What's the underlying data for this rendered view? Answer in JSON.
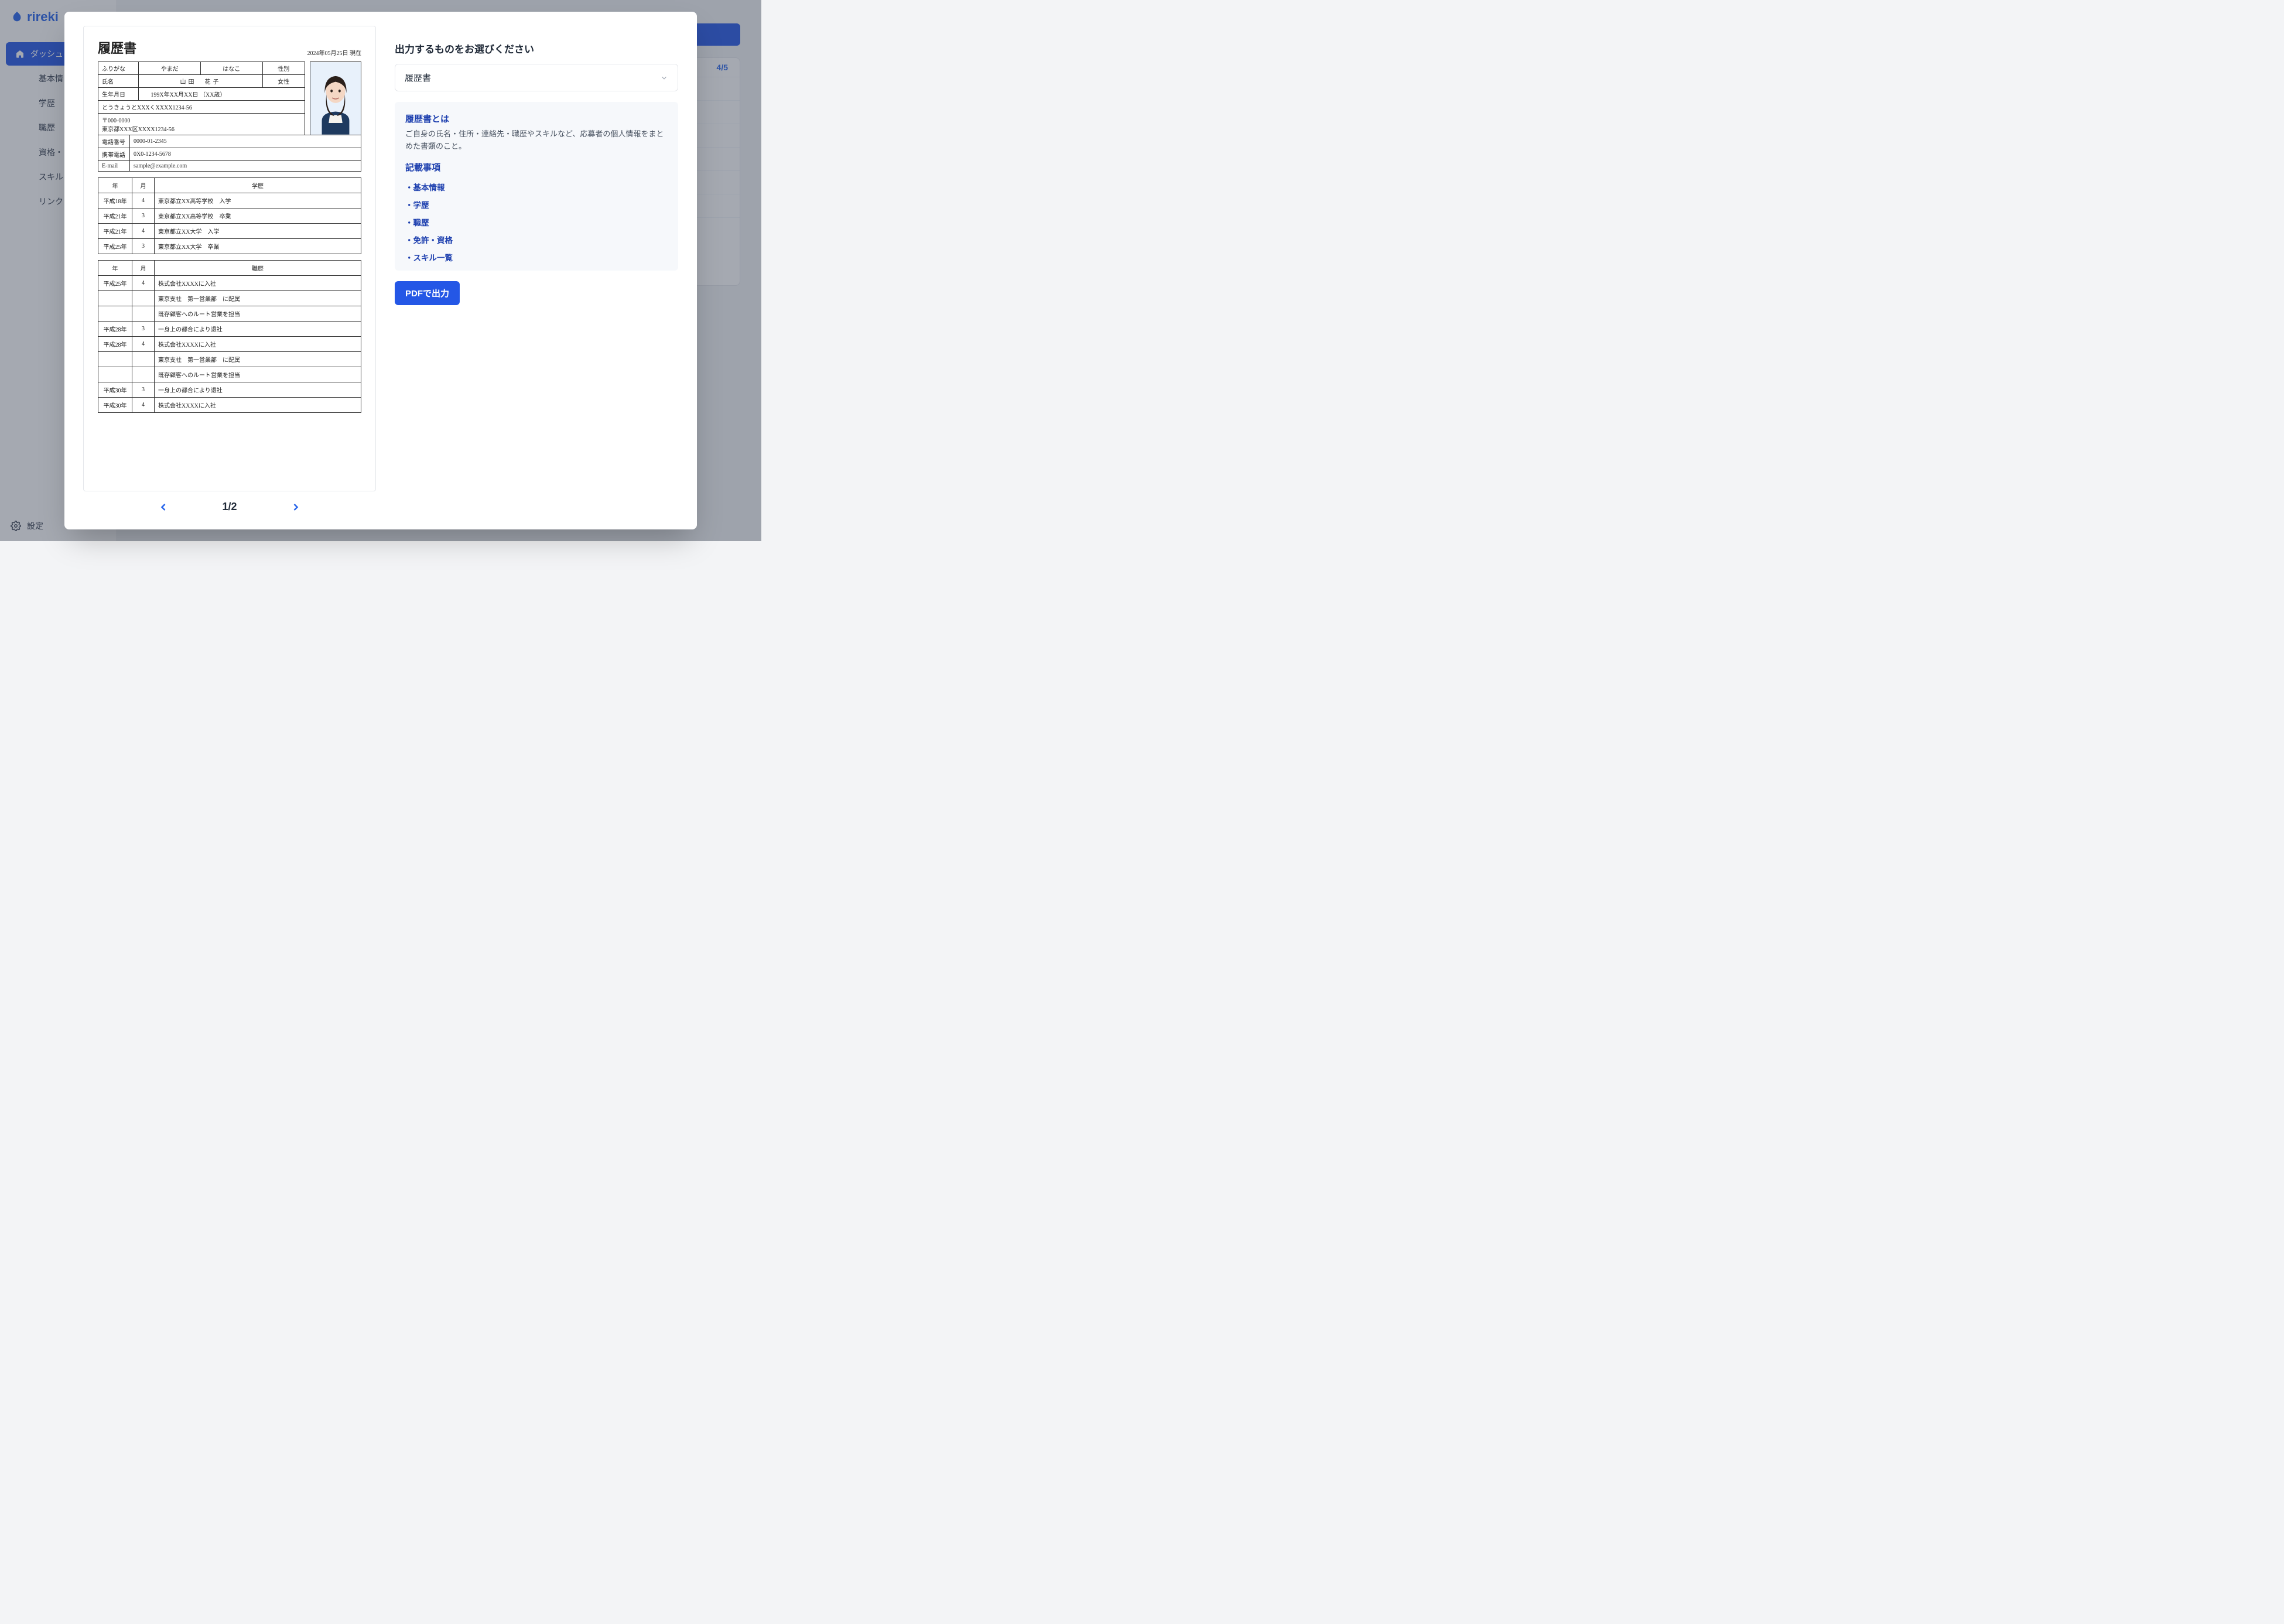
{
  "brand": "rireki",
  "sidebar": {
    "active": "ダッシュ",
    "items": [
      "基本情",
      "学歴",
      "職歴",
      "資格・",
      "スキル",
      "リンク"
    ],
    "settings": "設定"
  },
  "background": {
    "counter": "4/5"
  },
  "modal": {
    "preview": {
      "title": "履歴書",
      "date_label": "2024年05月25日 現在",
      "labels": {
        "furigana": "ふりがな",
        "name": "氏名",
        "gender_label": "性別",
        "dob_label": "生年月日",
        "phone_label": "電話番号",
        "mobile_label": "携帯電話",
        "email_label": "E-mail"
      },
      "person": {
        "furigana_sei": "やまだ",
        "furigana_mei": "はなこ",
        "name": "山田　花子",
        "gender": "女性",
        "dob": "199X年XX月XX日 （XX歳）",
        "addr_furigana": "とうきょうとXXXくXXXX1234-56",
        "zip": "〒000-0000",
        "addr": "東京都XXX区XXXX1234-56",
        "phone": "0000-01-2345",
        "mobile": "0X0-1234-5678",
        "email": "sample@example.com"
      },
      "education_header": {
        "year": "年",
        "month": "月",
        "title": "学歴"
      },
      "education": [
        {
          "year": "平成18年",
          "month": "4",
          "desc": "東京都立XX高等学校　入学"
        },
        {
          "year": "平成21年",
          "month": "3",
          "desc": "東京都立XX高等学校　卒業"
        },
        {
          "year": "平成21年",
          "month": "4",
          "desc": "東京都立XX大学　入学"
        },
        {
          "year": "平成25年",
          "month": "3",
          "desc": "東京都立XX大学　卒業"
        }
      ],
      "work_header": {
        "year": "年",
        "month": "月",
        "title": "職歴"
      },
      "work": [
        {
          "year": "平成25年",
          "month": "4",
          "desc": "株式会社XXXXに入社"
        },
        {
          "year": "",
          "month": "",
          "desc": "東京支社　第一営業部　に配属"
        },
        {
          "year": "",
          "month": "",
          "desc": "既存顧客へのルート営業を担当"
        },
        {
          "year": "平成28年",
          "month": "3",
          "desc": "一身上の都合により退社"
        },
        {
          "year": "平成28年",
          "month": "4",
          "desc": "株式会社XXXXに入社"
        },
        {
          "year": "",
          "month": "",
          "desc": "東京支社　第一営業部　に配属"
        },
        {
          "year": "",
          "month": "",
          "desc": "既存顧客へのルート営業を担当"
        },
        {
          "year": "平成30年",
          "month": "3",
          "desc": "一身上の都合により退社"
        },
        {
          "year": "平成30年",
          "month": "4",
          "desc": "株式会社XXXXに入社"
        }
      ],
      "page_current": "1",
      "page_total": "2"
    },
    "side": {
      "heading": "出力するものをお選びください",
      "select_value": "履歴書",
      "info_title1": "履歴書とは",
      "info_desc": "ご自身の氏名・住所・連絡先・職歴やスキルなど、応募者の個人情報をまとめた書類のこと。",
      "info_title2": "記載事項",
      "info_items": [
        "基本情報",
        "学歴",
        "職歴",
        "免許・資格",
        "スキル一覧"
      ],
      "pdf_button": "PDFで出力"
    }
  }
}
